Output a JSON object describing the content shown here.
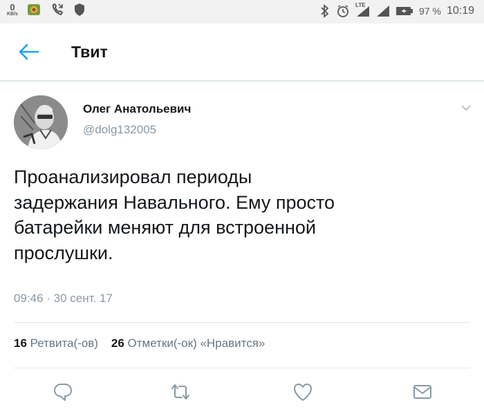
{
  "status_bar": {
    "speed_value": "0",
    "speed_unit": "KB/s",
    "network_type": "LTE",
    "battery_percent": "97 %",
    "time": "10:19"
  },
  "header": {
    "title": "Твит",
    "back_icon": "arrow-left-icon"
  },
  "tweet": {
    "author_name": "Олег Анатольевич",
    "author_handle": "@dolg132005",
    "text_lines": [
      "Проанализировал периоды",
      "задержания Навального. Ему просто",
      "батарейки меняют для встроенной",
      "прослушки."
    ],
    "timestamp": "09:46 · 30 сент. 17"
  },
  "stats": {
    "retweets_count": "16",
    "retweets_label": "Ретвита(-ов)",
    "likes_count": "26",
    "likes_label": "Отметки(-ок) «Нравится»"
  },
  "actions": {
    "reply_icon": "reply-icon",
    "retweet_icon": "retweet-icon",
    "like_icon": "heart-icon",
    "message_icon": "envelope-icon"
  },
  "colors": {
    "accent": "#1da1f2",
    "text": "#14171a",
    "secondary_text": "#8899a6",
    "divider": "#e1e8ed"
  }
}
